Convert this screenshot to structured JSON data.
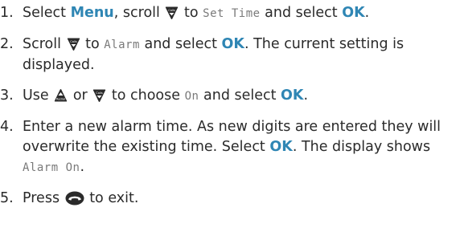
{
  "icons": {
    "calls": "calls-down-icon",
    "redial": "redial-up-icon",
    "end": "end-call-icon"
  },
  "colors": {
    "accent": "#2f86b4",
    "lcd_text": "#7a7a7a",
    "body_text": "#2a2a2a"
  },
  "steps": [
    {
      "number": "1.",
      "t1": "Select ",
      "menu": "Menu",
      "t2": ", scroll ",
      "t3": " to ",
      "lcd1": "Set Time",
      "t4": " and select ",
      "ok": "OK",
      "t5": "."
    },
    {
      "number": "2.",
      "t1": "Scroll ",
      "t2": " to ",
      "lcd1": "Alarm",
      "t3": " and select ",
      "ok": "OK",
      "t4": ". The current setting is displayed."
    },
    {
      "number": "3.",
      "t1": "Use ",
      "t2": " or ",
      "t3": " to choose ",
      "lcd1": "On",
      "t4": " and select ",
      "ok": "OK",
      "t5": "."
    },
    {
      "number": "4.",
      "t1": "Enter a new alarm time. As new digits are entered they will overwrite the existing time. Select ",
      "ok": "OK",
      "t2": ". The display shows ",
      "lcd1": "Alarm On",
      "t3": "."
    },
    {
      "number": "5.",
      "t1": "Press ",
      "t2": " to exit."
    }
  ]
}
